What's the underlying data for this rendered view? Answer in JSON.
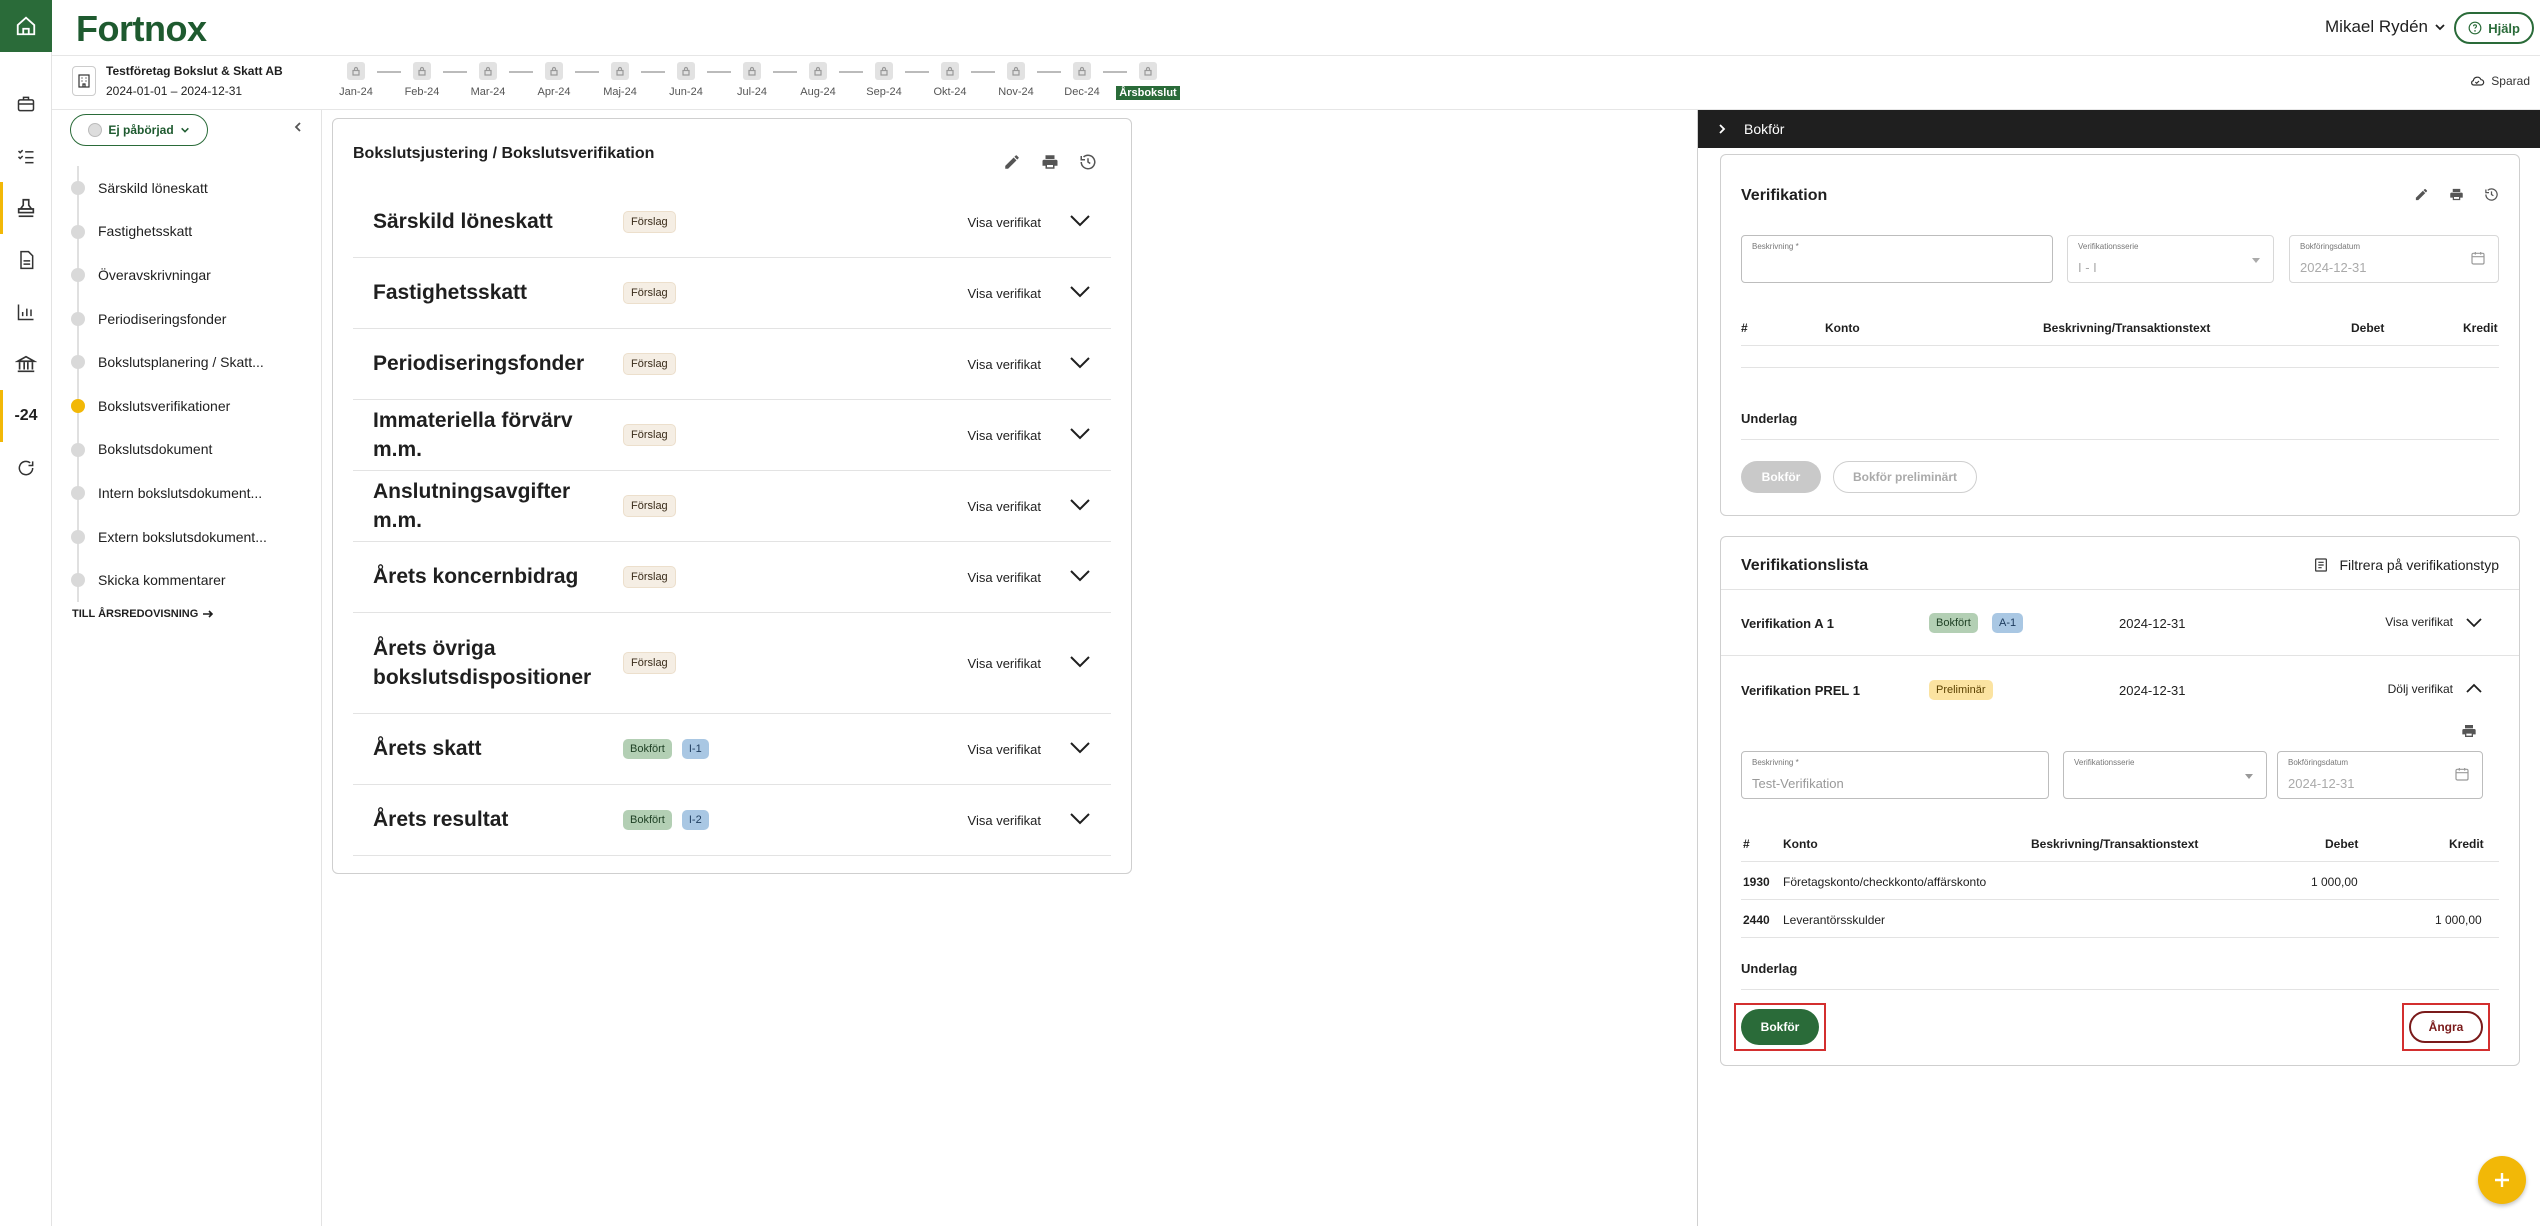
{
  "header": {
    "logo": "Fortnox",
    "user": "Mikael Rydén",
    "help": "Hjälp"
  },
  "company": {
    "name": "Testföretag Bokslut & Skatt AB",
    "period": "2024-01-01 – 2024-12-31"
  },
  "months": [
    "Jan-24",
    "Feb-24",
    "Mar-24",
    "Apr-24",
    "Maj-24",
    "Jun-24",
    "Jul-24",
    "Aug-24",
    "Sep-24",
    "Okt-24",
    "Nov-24",
    "Dec-24",
    "Årsbokslut"
  ],
  "saved": "Sparad",
  "rail": {
    "year_label": "-24"
  },
  "sidebar": {
    "status": "Ej påbörjad",
    "steps": [
      "Särskild löneskatt",
      "Fastighetsskatt",
      "Överavskrivningar",
      "Periodiseringsfonder",
      "Bokslutsplanering / Skatt...",
      "Bokslutsverifikationer",
      "Bokslutsdokument",
      "Intern bokslutsdokument...",
      "Extern bokslutsdokument...",
      "Skicka kommentarer"
    ],
    "to_annual": "TILL ÅRSREDOVISNING"
  },
  "center": {
    "title": "Bokslutsjustering / Bokslutsverifikation",
    "show_label": "Visa verifikat",
    "rows": [
      {
        "name": "Särskild löneskatt",
        "badges": [
          "Förslag"
        ]
      },
      {
        "name": "Fastighetsskatt",
        "badges": [
          "Förslag"
        ]
      },
      {
        "name": "Periodiseringsfonder",
        "badges": [
          "Förslag"
        ]
      },
      {
        "name": "Immateriella förvärv m.m.",
        "badges": [
          "Förslag"
        ]
      },
      {
        "name": "Anslutningsavgifter m.m.",
        "badges": [
          "Förslag"
        ]
      },
      {
        "name": "Årets koncernbidrag",
        "badges": [
          "Förslag"
        ]
      },
      {
        "name": "Årets övriga bokslutsdispositioner",
        "badges": [
          "Förslag"
        ]
      },
      {
        "name": "Årets skatt",
        "badges": [
          "Bokfört",
          "I-1"
        ]
      },
      {
        "name": "Årets resultat",
        "badges": [
          "Bokfört",
          "I-2"
        ]
      }
    ]
  },
  "right": {
    "bar_title": "Bokför",
    "verification": {
      "title": "Verifikation",
      "desc_label": "Beskrivning *",
      "series_label": "Verifikationsserie",
      "series_value": "I - I",
      "date_label": "Bokföringsdatum",
      "date_value": "2024-12-31",
      "cols": [
        "#",
        "Konto",
        "Beskrivning/Transaktionstext",
        "Debet",
        "Kredit"
      ],
      "underlag": "Underlag",
      "btn_post": "Bokför",
      "btn_prelim": "Bokför preliminärt"
    },
    "list": {
      "title": "Verifikationslista",
      "filter": "Filtrera på verifikationstyp",
      "item1": {
        "name": "Verifikation A 1",
        "badge1": "Bokfört",
        "badge2": "A-1",
        "date": "2024-12-31",
        "action": "Visa verifikat"
      },
      "item2": {
        "name": "Verifikation PREL 1",
        "badge1": "Preliminär",
        "date": "2024-12-31",
        "action": "Dölj verifikat"
      },
      "form": {
        "desc_label": "Beskrivning *",
        "desc_value": "Test-Verifikation",
        "series_label": "Verifikationsserie",
        "date_label": "Bokföringsdatum",
        "date_value": "2024-12-31"
      },
      "cols": [
        "#",
        "Konto",
        "Beskrivning/Transaktionstext",
        "Debet",
        "Kredit"
      ],
      "lines": [
        {
          "num": "1930",
          "account": "Företagskonto/checkkonto/affärskonto",
          "debet": "1 000,00",
          "kredit": ""
        },
        {
          "num": "2440",
          "account": "Leverantörsskulder",
          "debet": "",
          "kredit": "1 000,00"
        }
      ],
      "underlag": "Underlag",
      "btn_post": "Bokför",
      "btn_undo": "Ångra"
    }
  },
  "colors": {
    "brand": "#2a6b39",
    "accent": "#f2b807",
    "highlight": "#d32f2f"
  },
  "icons": [
    "home-icon",
    "briefcase-icon",
    "checklist-icon",
    "stamp-icon",
    "document-icon",
    "bar-chart-icon",
    "bank-icon",
    "refresh-icon",
    "pencil-icon",
    "print-icon",
    "history-icon",
    "chevron-down-icon",
    "chevron-up-icon",
    "calendar-icon",
    "cloud-icon",
    "plus-icon",
    "filter-icon"
  ]
}
